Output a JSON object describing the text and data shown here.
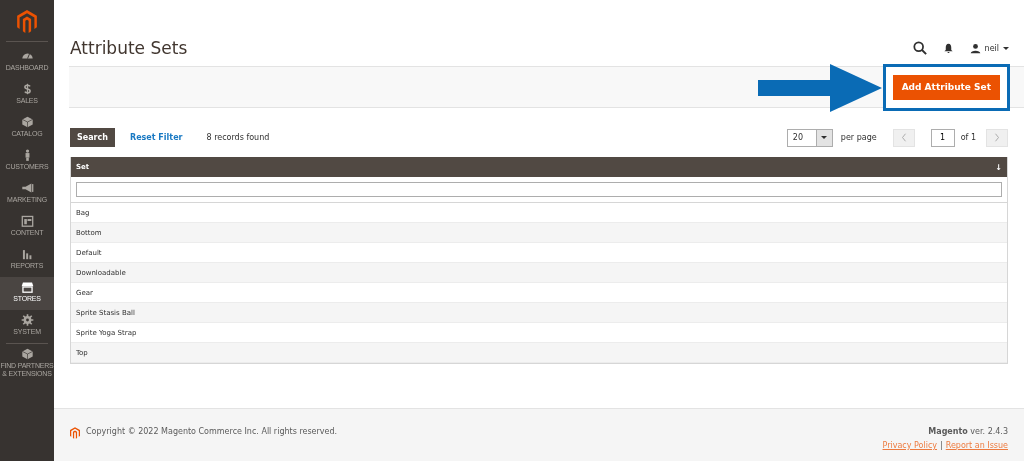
{
  "sidebar": {
    "items": [
      {
        "label": "DASHBOARD",
        "selected": false
      },
      {
        "label": "SALES",
        "selected": false
      },
      {
        "label": "CATALOG",
        "selected": false
      },
      {
        "label": "CUSTOMERS",
        "selected": false
      },
      {
        "label": "MARKETING",
        "selected": false
      },
      {
        "label": "CONTENT",
        "selected": false
      },
      {
        "label": "REPORTS",
        "selected": false
      },
      {
        "label": "STORES",
        "selected": true
      },
      {
        "label": "SYSTEM",
        "selected": false
      },
      {
        "label": "FIND PARTNERS & EXTENSIONS",
        "selected": false
      }
    ]
  },
  "header": {
    "title": "Attribute Sets",
    "user": "neil"
  },
  "actions": {
    "primary": "Add Attribute Set"
  },
  "toolbar": {
    "search": "Search",
    "reset": "Reset Filter",
    "count": "8 records found",
    "per_page_value": "20",
    "per_page_label": "per page",
    "page": "1",
    "of": "of 1"
  },
  "table": {
    "columns": [
      {
        "label": "Set",
        "sort": "↓"
      }
    ],
    "rows": [
      {
        "set": "Bag"
      },
      {
        "set": "Bottom"
      },
      {
        "set": "Default"
      },
      {
        "set": "Downloadable"
      },
      {
        "set": "Gear"
      },
      {
        "set": "Sprite Stasis Ball"
      },
      {
        "set": "Sprite Yoga Strap"
      },
      {
        "set": "Top"
      }
    ]
  },
  "footer": {
    "copyright": "Copyright © 2022 Magento Commerce Inc. All rights reserved.",
    "version": "**Magento** ver. 2.4.3",
    "links": [
      "Privacy Policy",
      "Report an Issue"
    ],
    "separator": "|"
  }
}
